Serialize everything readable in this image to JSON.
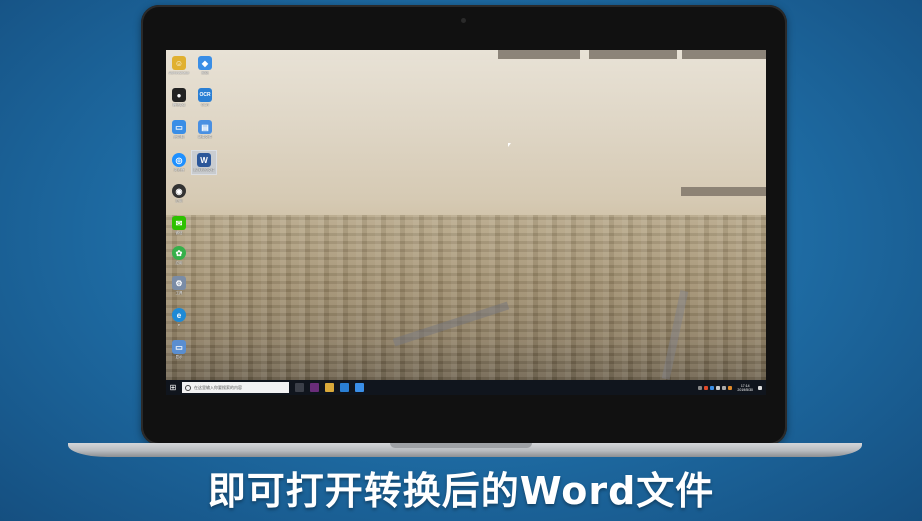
{
  "caption": "即可打开转换后的Word文件",
  "desktop_icons": [
    {
      "name": "user-folder-icon",
      "label": "Administrator",
      "color": "#e0b030"
    },
    {
      "name": "network-icon",
      "label": "网络",
      "color": "#3a8ee6"
    },
    {
      "name": "qq-icon",
      "label": "腾讯QQ",
      "color": "#222222"
    },
    {
      "name": "ocr-icon",
      "label": "OCR",
      "color": "#2a7fd4"
    },
    {
      "name": "desktop-icon",
      "label": "此电脑",
      "color": "#3a8ee6"
    },
    {
      "name": "file-icon",
      "label": "新建文件",
      "color": "#4a90e2"
    },
    {
      "name": "browser-icon",
      "label": "浏览器",
      "color": "#1e90ff"
    },
    {
      "name": "word-file-icon",
      "label": "转换后的文件",
      "color": "#2b579a"
    },
    {
      "name": "app-icon",
      "label": "应用",
      "color": "#333333"
    },
    {
      "name": "wechat-icon",
      "label": "微信",
      "color": "#2dc100"
    },
    {
      "name": "green-app-icon",
      "label": "应用",
      "color": "#36b04a"
    },
    {
      "name": "tool-icon",
      "label": "工具",
      "color": "#7a8ca6"
    },
    {
      "name": "ie-icon",
      "label": "e",
      "color": "#1e8ad6"
    },
    {
      "name": "monitor-icon",
      "label": "显示",
      "color": "#5a8ed0"
    }
  ],
  "taskbar": {
    "start_glyph": "⊞",
    "search_placeholder": "在这里输入你要搜索的内容",
    "clock_time": "17:14",
    "clock_date": "2019/5/30"
  },
  "colors": {
    "background": "#1f6fa8",
    "taskbar": "#10151d",
    "caption": "#ffffff"
  }
}
